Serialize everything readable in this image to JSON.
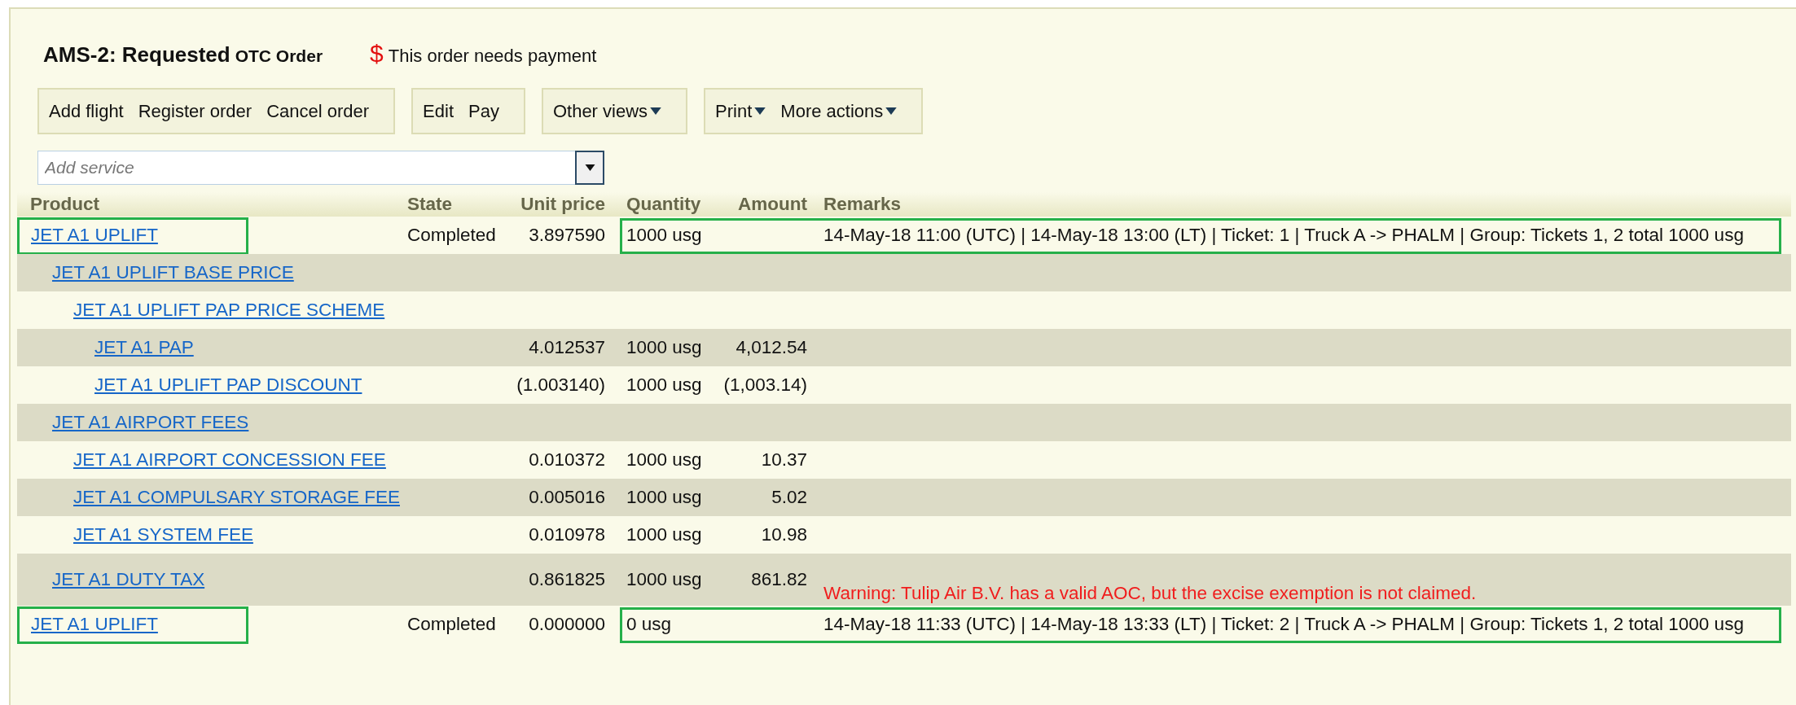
{
  "header": {
    "title": "AMS-2: Requested",
    "subtitle": "OTC Order",
    "notice_symbol": "$",
    "notice": "This order needs payment"
  },
  "toolbar": [
    {
      "buttons": [
        {
          "label": "Add flight",
          "menu": false
        },
        {
          "label": "Register order",
          "menu": false
        },
        {
          "label": "Cancel order",
          "menu": false
        }
      ]
    },
    {
      "buttons": [
        {
          "label": "Edit",
          "menu": false
        },
        {
          "label": "Pay",
          "menu": false
        }
      ]
    },
    {
      "buttons": [
        {
          "label": "Other views",
          "menu": true
        }
      ]
    },
    {
      "buttons": [
        {
          "label": "Print",
          "menu": true
        },
        {
          "label": "More actions",
          "menu": true
        }
      ]
    }
  ],
  "add_service": {
    "placeholder": "Add service"
  },
  "table": {
    "columns": [
      "Product",
      "State",
      "Unit price",
      "Quantity",
      "Amount",
      "Remarks"
    ],
    "rows": [
      {
        "product": "JET A1 UPLIFT",
        "state": "Completed",
        "unit_price": "3.897590",
        "quantity": "1000 usg",
        "remarks": "14-May-18 11:00 (UTC) | 14-May-18 13:00 (LT) | Ticket: 1 | Truck A -> PHALM | Group: Tickets 1, 2 total 1000 usg",
        "highlighted": true,
        "children": [
          {
            "product": "JET A1 UPLIFT BASE PRICE",
            "highlighted": false,
            "children": [
              {
                "product": "JET A1 UPLIFT PAP PRICE SCHEME",
                "highlighted": false,
                "children": [
                  {
                    "product": "JET A1 PAP",
                    "unit_price": "4.012537",
                    "quantity": "1000 usg",
                    "amount": "4,012.54",
                    "highlighted": false
                  },
                  {
                    "product": "JET A1 UPLIFT PAP DISCOUNT",
                    "unit_price": "(1.003140)",
                    "quantity": "1000 usg",
                    "amount": "(1,003.14)",
                    "highlighted": false
                  }
                ]
              }
            ]
          },
          {
            "product": "JET A1 AIRPORT FEES",
            "highlighted": false,
            "children": [
              {
                "product": "JET A1 AIRPORT CONCESSION FEE",
                "unit_price": "0.010372",
                "quantity": "1000 usg",
                "amount": "10.37",
                "highlighted": false
              },
              {
                "product": "JET A1 COMPULSARY STORAGE FEE",
                "unit_price": "0.005016",
                "quantity": "1000 usg",
                "amount": "5.02",
                "highlighted": false
              },
              {
                "product": "JET A1 SYSTEM FEE",
                "unit_price": "0.010978",
                "quantity": "1000 usg",
                "amount": "10.98",
                "highlighted": false
              }
            ]
          },
          {
            "product": "JET A1 DUTY TAX",
            "unit_price": "0.861825",
            "quantity": "1000 usg",
            "amount": "861.82",
            "warning": "Warning: Tulip Air B.V. has a valid AOC, but the excise exemption is not claimed.",
            "highlighted": false
          }
        ]
      },
      {
        "product": "JET A1 UPLIFT",
        "state": "Completed",
        "unit_price": "0.000000",
        "quantity": "0 usg",
        "remarks": "14-May-18 11:33 (UTC) | 14-May-18 13:33 (LT) | Ticket: 2 | Truck A -> PHALM | Group: Tickets 1, 2 total 1000 usg",
        "highlighted": true
      }
    ]
  }
}
